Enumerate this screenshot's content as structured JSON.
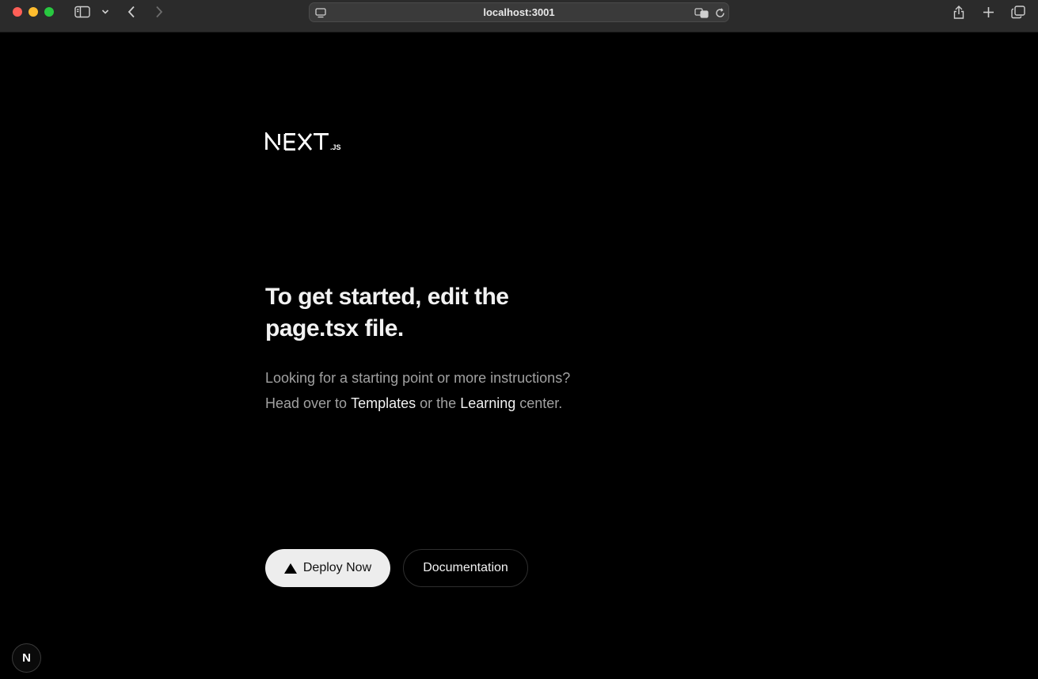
{
  "browser": {
    "url": "localhost:3001"
  },
  "logo": {
    "text": "NEXT",
    "suffix": ".JS"
  },
  "main": {
    "heading": "To get started, edit the page.tsx file.",
    "description_line1": "Looking for a starting point or more instructions?",
    "description_prefix": "Head over to",
    "templates_link": "Templates",
    "description_middle": "or the",
    "learning_link": "Learning",
    "description_suffix": "center."
  },
  "buttons": {
    "deploy_label": "Deploy Now",
    "docs_label": "Documentation"
  },
  "dev_indicator": {
    "letter": "N"
  },
  "colors": {
    "background": "#000000",
    "deploy_button": "#ededed",
    "text_primary": "#f2f2f2",
    "text_secondary": "#a1a1a1"
  }
}
